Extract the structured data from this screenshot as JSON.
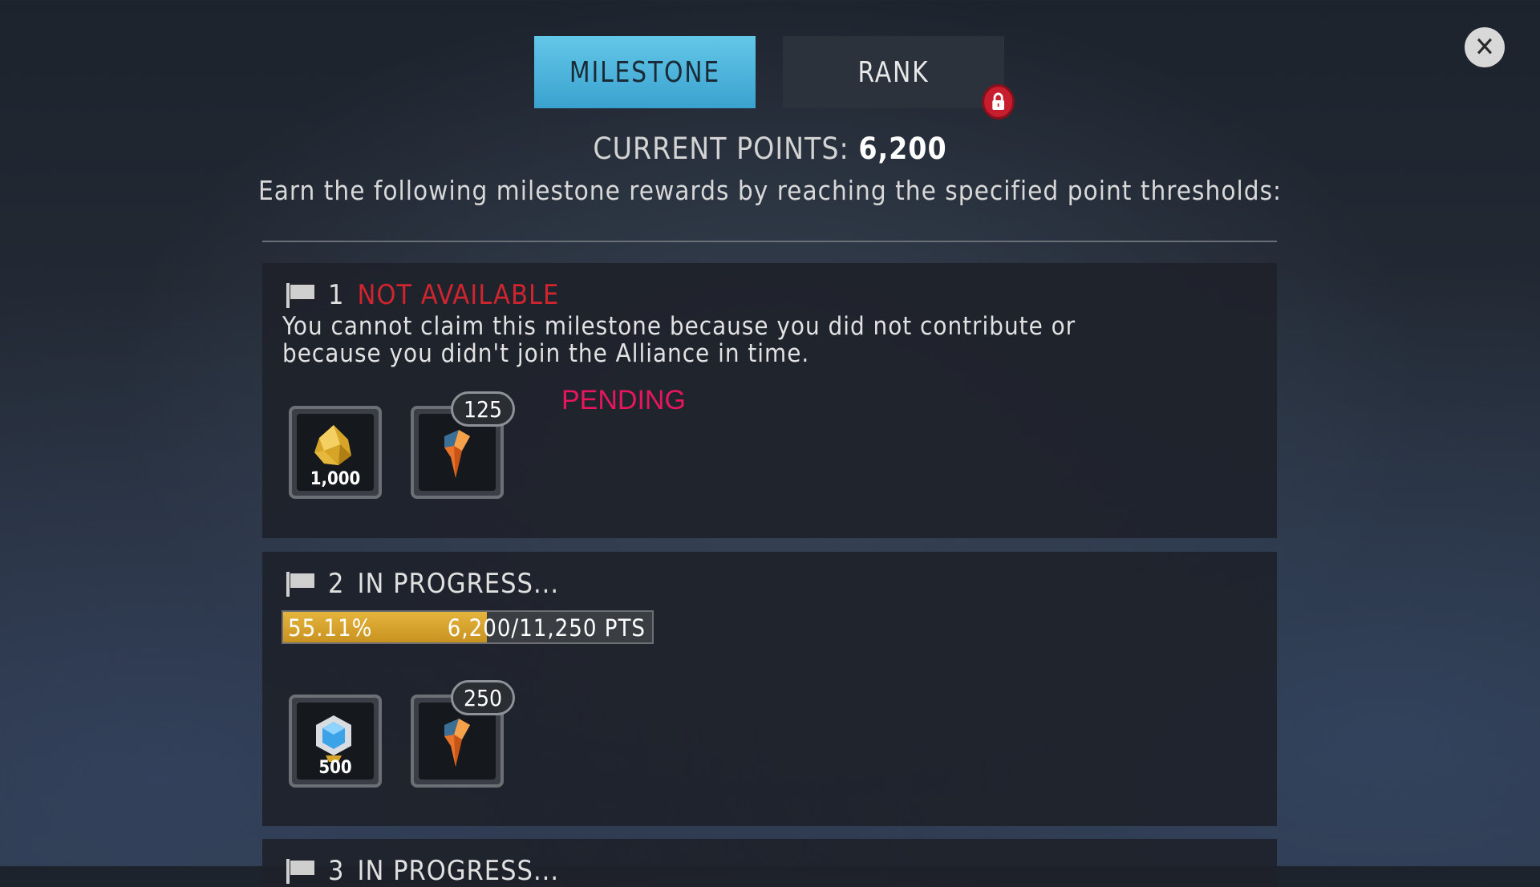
{
  "tabs": [
    {
      "label": "MILESTONE",
      "active": true
    },
    {
      "label": "RANK",
      "active": false,
      "locked": true
    }
  ],
  "close_icon": "close-icon",
  "header": {
    "points_label": "CURRENT POINTS:",
    "points_value": "6,200",
    "subtitle": "Earn the following milestone rewards by reaching the specified point thresholds:"
  },
  "milestones": [
    {
      "number": "1",
      "status": "NOT AVAILABLE",
      "status_color": "#d0242e",
      "description_line1": "You cannot claim this milestone because you did not contribute or",
      "description_line2": "because you didn't join the Alliance in time.",
      "pending_label": "PENDING",
      "pending_color": "#e8175d",
      "rewards": [
        {
          "icon": "gold-ore-icon",
          "quantity": "1,000"
        },
        {
          "icon": "lightning-crystal-icon",
          "badge": "125"
        }
      ]
    },
    {
      "number": "2",
      "status": "IN PROGRESS...",
      "progress": {
        "percent_text": "55.11%",
        "fraction": 0.5511,
        "points_text": "6,200/11,250 PTS"
      },
      "rewards": [
        {
          "icon": "blue-gem-icon",
          "quantity": "500"
        },
        {
          "icon": "lightning-crystal-icon",
          "badge": "250"
        }
      ]
    },
    {
      "number": "3",
      "status": "IN PROGRESS..."
    }
  ]
}
